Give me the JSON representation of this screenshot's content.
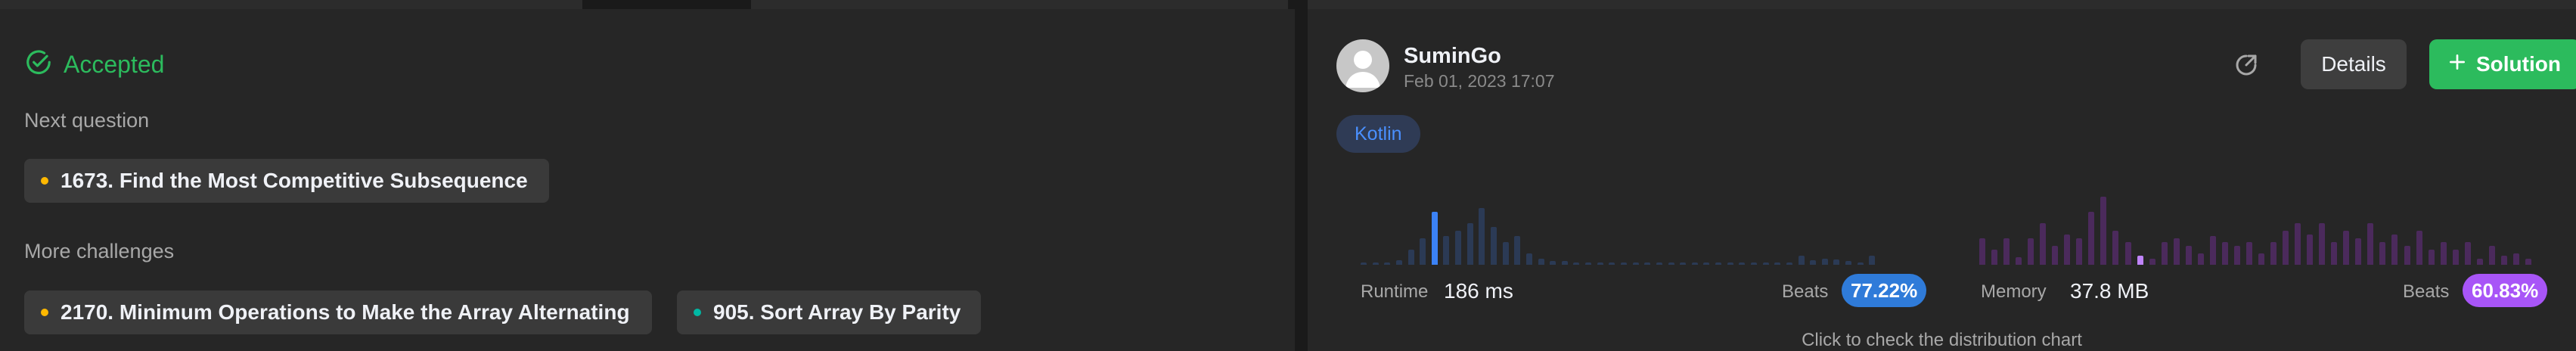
{
  "result": {
    "status": "Accepted"
  },
  "next_question": {
    "label": "Next question",
    "items": [
      {
        "title": "1673. Find the Most Competitive Subsequence",
        "difficulty": "Medium"
      }
    ]
  },
  "more_challenges": {
    "label": "More challenges",
    "items": [
      {
        "title": "2170. Minimum Operations to Make the Array Alternating",
        "difficulty": "Medium"
      },
      {
        "title": "905. Sort Array By Parity",
        "difficulty": "Easy"
      }
    ]
  },
  "submission": {
    "username": "SuminGo",
    "date": "Feb 01, 2023 17:07",
    "language": "Kotlin",
    "details_label": "Details",
    "solution_label": "Solution"
  },
  "runtime": {
    "label": "Runtime",
    "value": "186 ms",
    "beats_label": "Beats",
    "beats": "77.22%",
    "color": "#2f7bd9",
    "highlight_color": "#3b82f6",
    "bar_color": "#2b3a55",
    "distribution": [
      0.03,
      0.03,
      0.03,
      0.06,
      0.2,
      0.35,
      0.7,
      0.38,
      0.45,
      0.55,
      0.75,
      0.5,
      0.3,
      0.38,
      0.15,
      0.08,
      0.05,
      0.05,
      0.03,
      0.03,
      0.03,
      0.03,
      0.03,
      0.03,
      0.03,
      0.03,
      0.03,
      0.03,
      0.03,
      0.03,
      0.03,
      0.03,
      0.03,
      0.03,
      0.03,
      0.03,
      0.03,
      0.12,
      0.06,
      0.08,
      0.07,
      0.05,
      0.03,
      0.12
    ],
    "highlight_index": 6
  },
  "memory": {
    "label": "Memory",
    "value": "37.8 MB",
    "beats_label": "Beats",
    "beats": "60.83%",
    "color": "#a855f7",
    "highlight_color": "#c084fc",
    "bar_color": "#4b2a5c",
    "distribution": [
      0.35,
      0.2,
      0.35,
      0.1,
      0.35,
      0.55,
      0.25,
      0.4,
      0.35,
      0.7,
      0.9,
      0.45,
      0.3,
      0.12,
      0.08,
      0.3,
      0.35,
      0.25,
      0.15,
      0.38,
      0.3,
      0.25,
      0.3,
      0.15,
      0.3,
      0.45,
      0.55,
      0.4,
      0.55,
      0.3,
      0.45,
      0.35,
      0.55,
      0.3,
      0.4,
      0.25,
      0.45,
      0.2,
      0.3,
      0.2,
      0.3,
      0.08,
      0.25,
      0.12,
      0.15,
      0.08
    ],
    "highlight_index": 13
  },
  "hint": "Click to check the distribution chart"
}
